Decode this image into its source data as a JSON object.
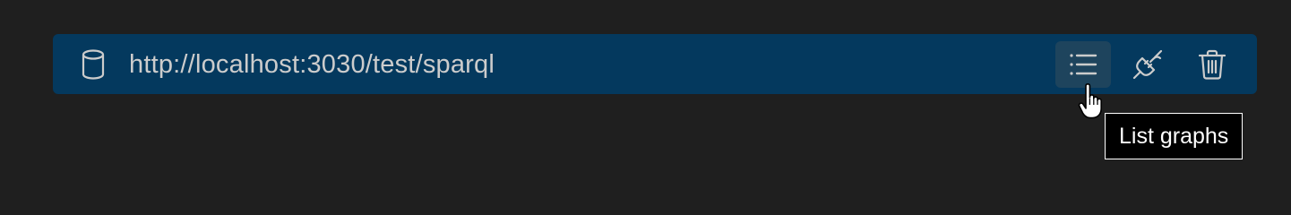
{
  "endpoint": {
    "url": "http://localhost:3030/test/sparql",
    "icon": "database-icon"
  },
  "actions": [
    {
      "name": "list-graphs",
      "icon": "list-icon",
      "hovered": true
    },
    {
      "name": "disconnect",
      "icon": "plug-disconnect-icon",
      "hovered": false
    },
    {
      "name": "delete",
      "icon": "trash-icon",
      "hovered": false
    }
  ],
  "tooltip": {
    "text": "List graphs"
  },
  "colors": {
    "background": "#1f1f1f",
    "row_selected": "#04395e",
    "text": "#cccccc",
    "tooltip_bg": "#000000",
    "tooltip_border": "#ffffff"
  }
}
